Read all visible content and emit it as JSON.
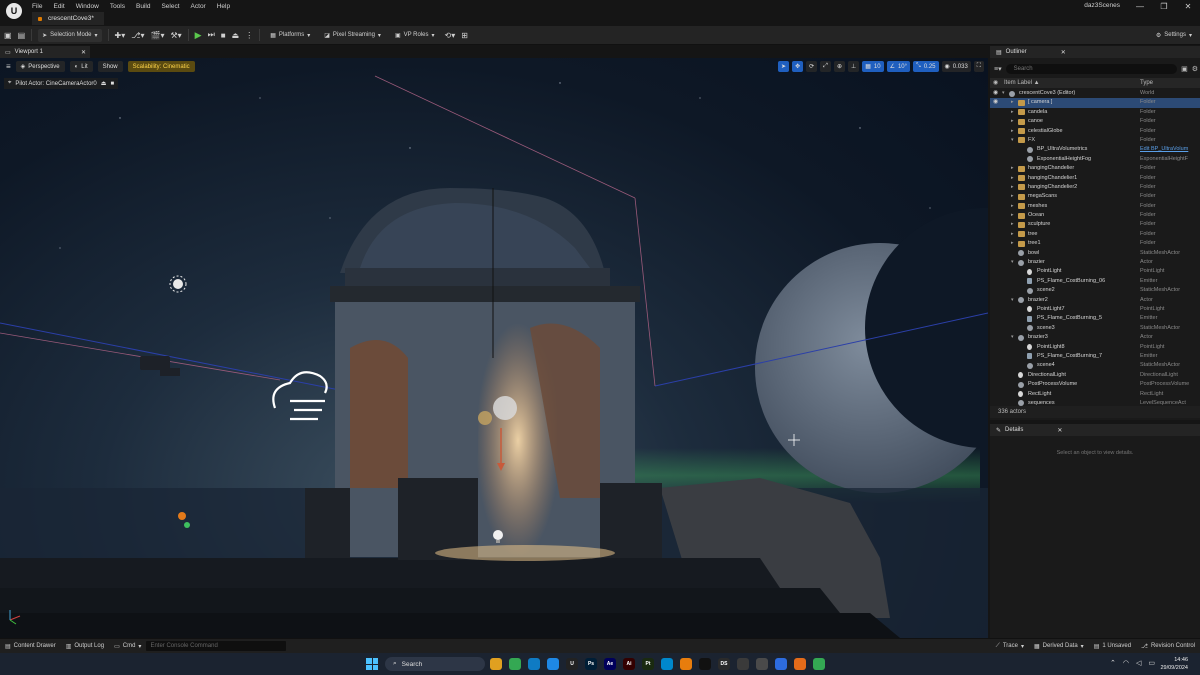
{
  "titlebar": {
    "menu": [
      "File",
      "Edit",
      "Window",
      "Tools",
      "Build",
      "Select",
      "Actor",
      "Help"
    ],
    "document_tab": "crescentCove3*",
    "project_name": "daz3Scenes",
    "window_controls": [
      "—",
      "❐",
      "✕"
    ]
  },
  "toolbar": {
    "selection_mode": "Selection Mode",
    "platforms": "Platforms",
    "pixel_streaming": "Pixel Streaming",
    "vp_roles": "VP Roles",
    "settings": "Settings"
  },
  "viewport": {
    "tab_label": "Viewport 1",
    "perspective": "Perspective",
    "lit": "Lit",
    "show": "Show",
    "scalability": "Scalability: Cinematic",
    "grid_snap": "10",
    "rot_snap": "10°",
    "scale_snap": "0.25",
    "camera_speed": "0.033",
    "pilot_label": "Pilot Actor: CineCameraActor0"
  },
  "outliner": {
    "tab_label": "Outliner",
    "search_placeholder": "Search",
    "col_label": "Item Label ▲",
    "col_type": "Type",
    "rows": [
      {
        "name": "crescentCove3 (Editor)",
        "type": "World",
        "depth": 0,
        "icon": "actor",
        "exp": "▾"
      },
      {
        "name": "[ camera ]",
        "type": "Folder",
        "depth": 1,
        "icon": "folder",
        "exp": "▸",
        "selected": true
      },
      {
        "name": "candela",
        "type": "Folder",
        "depth": 1,
        "icon": "folder",
        "exp": "▸"
      },
      {
        "name": "canoe",
        "type": "Folder",
        "depth": 1,
        "icon": "folder",
        "exp": "▸"
      },
      {
        "name": "celestialGlobe",
        "type": "Folder",
        "depth": 1,
        "icon": "folder",
        "exp": "▸"
      },
      {
        "name": "FX",
        "type": "Folder",
        "depth": 1,
        "icon": "folder",
        "exp": "▾"
      },
      {
        "name": "BP_UltraVolumetrics",
        "type": "Edit BP_UltraVolum",
        "depth": 2,
        "icon": "actor",
        "exp": "",
        "link": true
      },
      {
        "name": "ExponentialHeightFog",
        "type": "ExponentialHeightF",
        "depth": 2,
        "icon": "actor",
        "exp": ""
      },
      {
        "name": "hangingChandelier",
        "type": "Folder",
        "depth": 1,
        "icon": "folder",
        "exp": "▸"
      },
      {
        "name": "hangingChandelier1",
        "type": "Folder",
        "depth": 1,
        "icon": "folder",
        "exp": "▸"
      },
      {
        "name": "hangingChandelier2",
        "type": "Folder",
        "depth": 1,
        "icon": "folder",
        "exp": "▸"
      },
      {
        "name": "megaScans",
        "type": "Folder",
        "depth": 1,
        "icon": "folder",
        "exp": "▸"
      },
      {
        "name": "meshes",
        "type": "Folder",
        "depth": 1,
        "icon": "folder",
        "exp": "▸"
      },
      {
        "name": "Ocean",
        "type": "Folder",
        "depth": 1,
        "icon": "folder",
        "exp": "▸"
      },
      {
        "name": "sculpture",
        "type": "Folder",
        "depth": 1,
        "icon": "folder",
        "exp": "▸"
      },
      {
        "name": "tree",
        "type": "Folder",
        "depth": 1,
        "icon": "folder",
        "exp": "▸"
      },
      {
        "name": "tree1",
        "type": "Folder",
        "depth": 1,
        "icon": "folder",
        "exp": "▸"
      },
      {
        "name": "bowl",
        "type": "StaticMeshActor",
        "depth": 1,
        "icon": "actor",
        "exp": ""
      },
      {
        "name": "brazier",
        "type": "Actor",
        "depth": 1,
        "icon": "actor",
        "exp": "▾"
      },
      {
        "name": "PointLight",
        "type": "PointLight",
        "depth": 2,
        "icon": "light",
        "exp": ""
      },
      {
        "name": "PS_Flame_CostBurning_06",
        "type": "Emitter",
        "depth": 2,
        "icon": "emit",
        "exp": ""
      },
      {
        "name": "scene2",
        "type": "StaticMeshActor",
        "depth": 2,
        "icon": "actor",
        "exp": ""
      },
      {
        "name": "brazier2",
        "type": "Actor",
        "depth": 1,
        "icon": "actor",
        "exp": "▾"
      },
      {
        "name": "PointLight7",
        "type": "PointLight",
        "depth": 2,
        "icon": "light",
        "exp": ""
      },
      {
        "name": "PS_Flame_CostBurning_5",
        "type": "Emitter",
        "depth": 2,
        "icon": "emit",
        "exp": ""
      },
      {
        "name": "scene3",
        "type": "StaticMeshActor",
        "depth": 2,
        "icon": "actor",
        "exp": ""
      },
      {
        "name": "brazier3",
        "type": "Actor",
        "depth": 1,
        "icon": "actor",
        "exp": "▾"
      },
      {
        "name": "PointLight8",
        "type": "PointLight",
        "depth": 2,
        "icon": "light",
        "exp": ""
      },
      {
        "name": "PS_Flame_CostBurning_7",
        "type": "Emitter",
        "depth": 2,
        "icon": "emit",
        "exp": ""
      },
      {
        "name": "scene4",
        "type": "StaticMeshActor",
        "depth": 2,
        "icon": "actor",
        "exp": ""
      },
      {
        "name": "DirectionalLight",
        "type": "DirectionalLight",
        "depth": 1,
        "icon": "light",
        "exp": ""
      },
      {
        "name": "PostProcessVolume",
        "type": "PostProcessVolume",
        "depth": 1,
        "icon": "actor",
        "exp": ""
      },
      {
        "name": "RectLight",
        "type": "RectLight",
        "depth": 1,
        "icon": "light",
        "exp": ""
      },
      {
        "name": "sequences",
        "type": "LevelSequenceAct",
        "depth": 1,
        "icon": "actor",
        "exp": ""
      }
    ],
    "actor_count": "336 actors"
  },
  "details": {
    "tab_label": "Details",
    "hint": "Select an object to view details."
  },
  "statusbar": {
    "content_drawer": "Content Drawer",
    "output_log": "Output Log",
    "cmd": "Cmd",
    "console_placeholder": "Enter Console Command",
    "trace": "Trace",
    "derived_data": "Derived Data",
    "unsaved": "1 Unsaved",
    "revision_control": "Revision Control"
  },
  "taskbar": {
    "search": "Search",
    "time": "14:46",
    "date": "29/09/2024",
    "apps": [
      {
        "label": "",
        "color": "#e0a020"
      },
      {
        "label": "",
        "color": "#34a853"
      },
      {
        "label": "",
        "color": "#0f7bc4"
      },
      {
        "label": "",
        "color": "#1e88e5"
      },
      {
        "label": "U",
        "color": "#222222"
      },
      {
        "label": "Ps",
        "color": "#001e36"
      },
      {
        "label": "Ae",
        "color": "#00005b"
      },
      {
        "label": "Ai",
        "color": "#330000"
      },
      {
        "label": "Pt",
        "color": "#1a2a10"
      },
      {
        "label": "",
        "color": "#0088cc"
      },
      {
        "label": "",
        "color": "#e87d0d"
      },
      {
        "label": "",
        "color": "#111111"
      },
      {
        "label": "DS",
        "color": "#2a2a2a"
      },
      {
        "label": "",
        "color": "#3a3a3a"
      },
      {
        "label": "",
        "color": "#4a4a4a"
      },
      {
        "label": "",
        "color": "#2d6cdf"
      },
      {
        "label": "",
        "color": "#e36b1a"
      },
      {
        "label": "",
        "color": "#34a853"
      }
    ]
  },
  "colors": {
    "selection": "#2c4a75",
    "folder": "#c49a4a",
    "play": "#5bc84d",
    "accent_blue": "#1f5fbf"
  }
}
